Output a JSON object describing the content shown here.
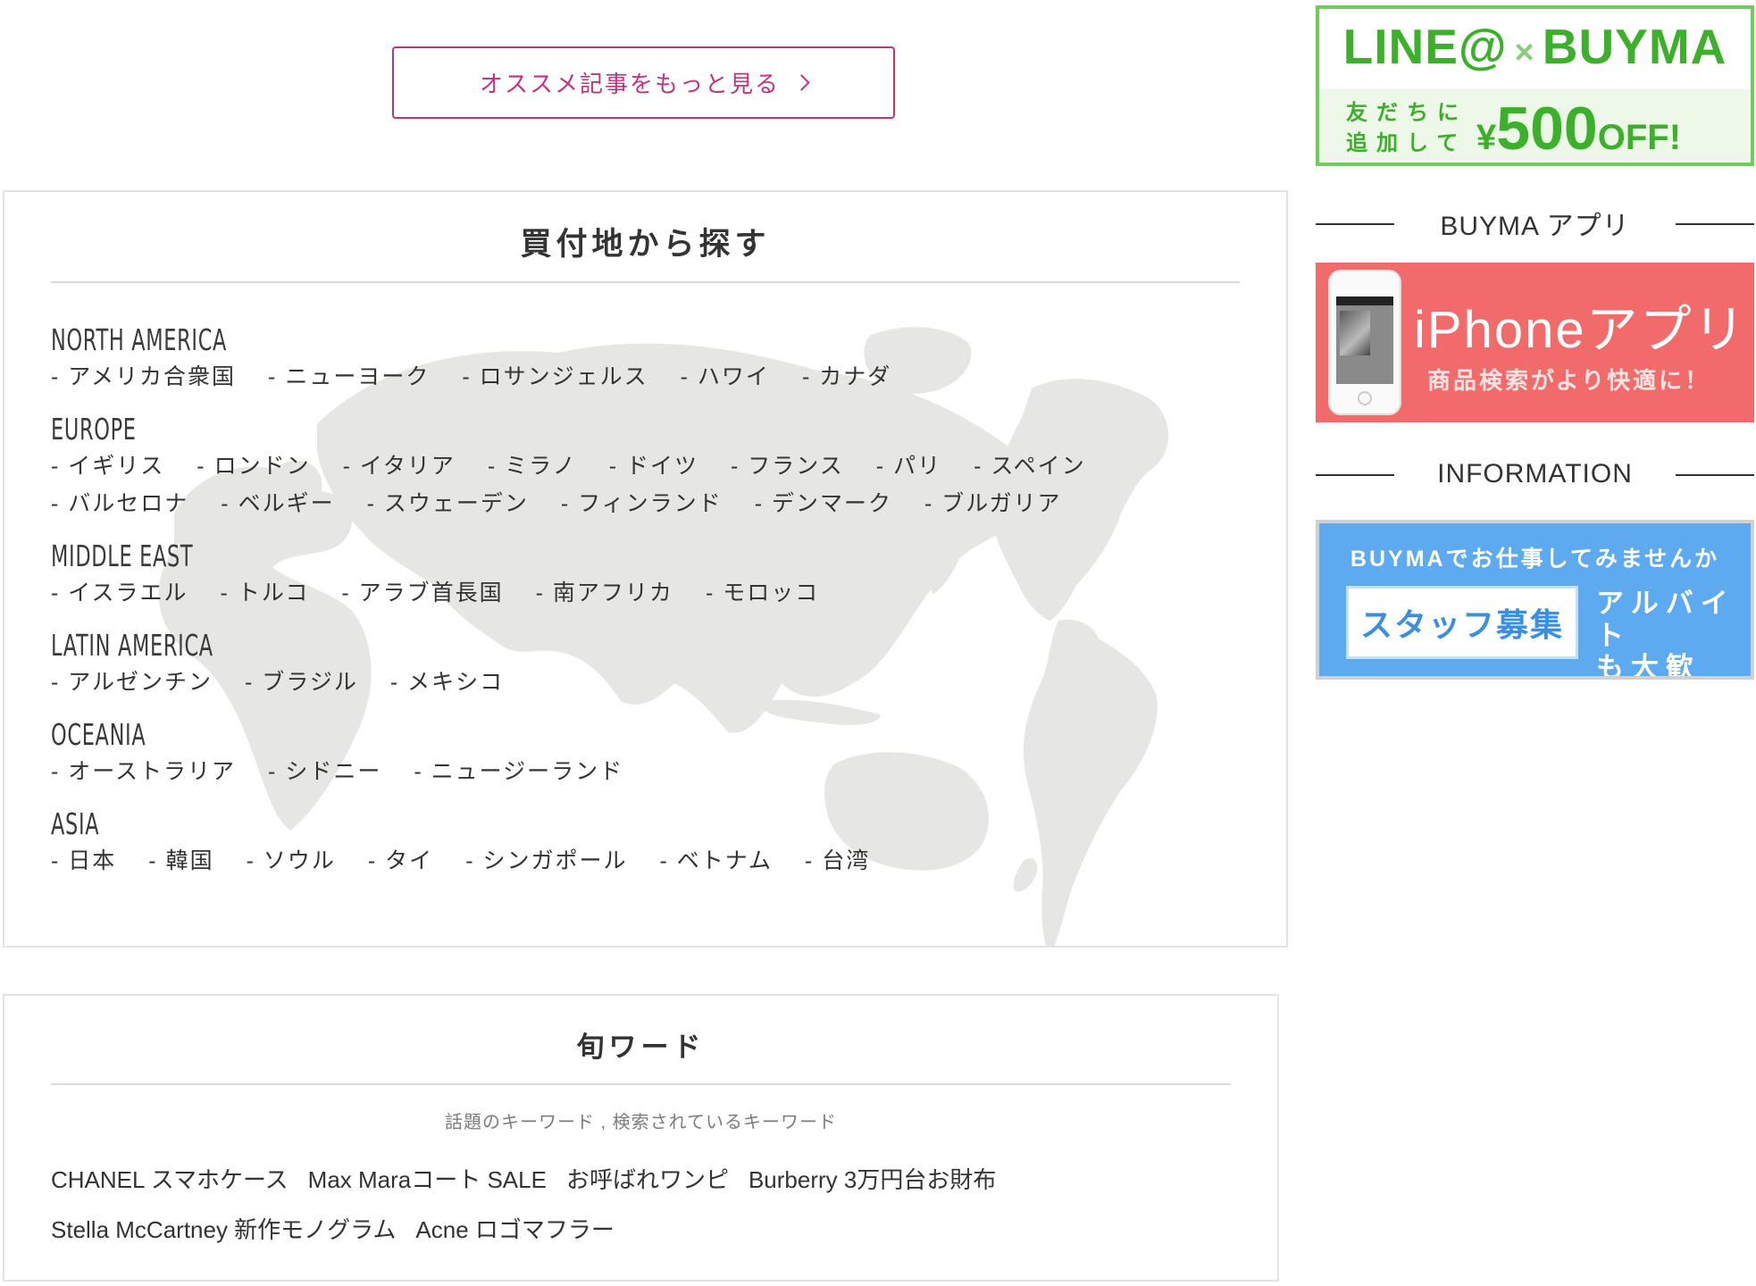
{
  "more_button": {
    "label": "オススメ記事をもっと見る",
    "icon": "chevron-right-icon"
  },
  "regions_panel": {
    "title": "買付地から探す",
    "regions": [
      {
        "name": "NORTH AMERICA",
        "links": [
          "アメリカ合衆国",
          "ニューヨーク",
          "ロサンジェルス",
          "ハワイ",
          "カナダ"
        ]
      },
      {
        "name": "EUROPE",
        "links": [
          "イギリス",
          "ロンドン",
          "イタリア",
          "ミラノ",
          "ドイツ",
          "フランス",
          "パリ",
          "スペイン",
          "バルセロナ",
          "ベルギー",
          "スウェーデン",
          "フィンランド",
          "デンマーク",
          "ブルガリア"
        ]
      },
      {
        "name": "MIDDLE EAST",
        "links": [
          "イスラエル",
          "トルコ",
          "アラブ首長国",
          "南アフリカ",
          "モロッコ"
        ]
      },
      {
        "name": "LATIN AMERICA",
        "links": [
          "アルゼンチン",
          "ブラジル",
          "メキシコ"
        ]
      },
      {
        "name": "OCEANIA",
        "links": [
          "オーストラリア",
          "シドニー",
          "ニュージーランド"
        ]
      },
      {
        "name": "ASIA",
        "links": [
          "日本",
          "韓国",
          "ソウル",
          "タイ",
          "シンガポール",
          "ベトナム",
          "台湾"
        ]
      }
    ]
  },
  "trend_panel": {
    "title": "旬ワード",
    "subtitle": "話題のキーワード , 検索されているキーワード",
    "words": [
      "CHANEL スマホケース",
      "Max Maraコート SALE",
      "お呼ばれワンピ",
      "Burberry 3万円台お財布",
      "Stella McCartney 新作モノグラム",
      "Acne ロゴマフラー"
    ]
  },
  "sidebar": {
    "line_banner": {
      "brand_left": "LINE@",
      "cross": "×",
      "brand_right": "BUYMA",
      "small_line1": "友だちに",
      "small_line2": "追加して",
      "yen": "¥",
      "amount": "500",
      "off": "OFF!"
    },
    "app_heading": "BUYMA アプリ",
    "iphone_banner": {
      "title": "iPhoneアプリ",
      "subtitle": "商品検索がより快適に！"
    },
    "info_heading": "INFORMATION",
    "staff_banner": {
      "top": "BUYMAでお仕事してみませんか",
      "box": "スタッフ募集",
      "right_line1": "アルバイト",
      "right_line2": "も大歓迎！"
    }
  },
  "colors": {
    "accent_pink": "#c4327f",
    "line_green": "#3db02b",
    "iphone_red": "#f26b6b",
    "staff_blue": "#5eaaf0",
    "map_gray": "#e6e6e4"
  }
}
